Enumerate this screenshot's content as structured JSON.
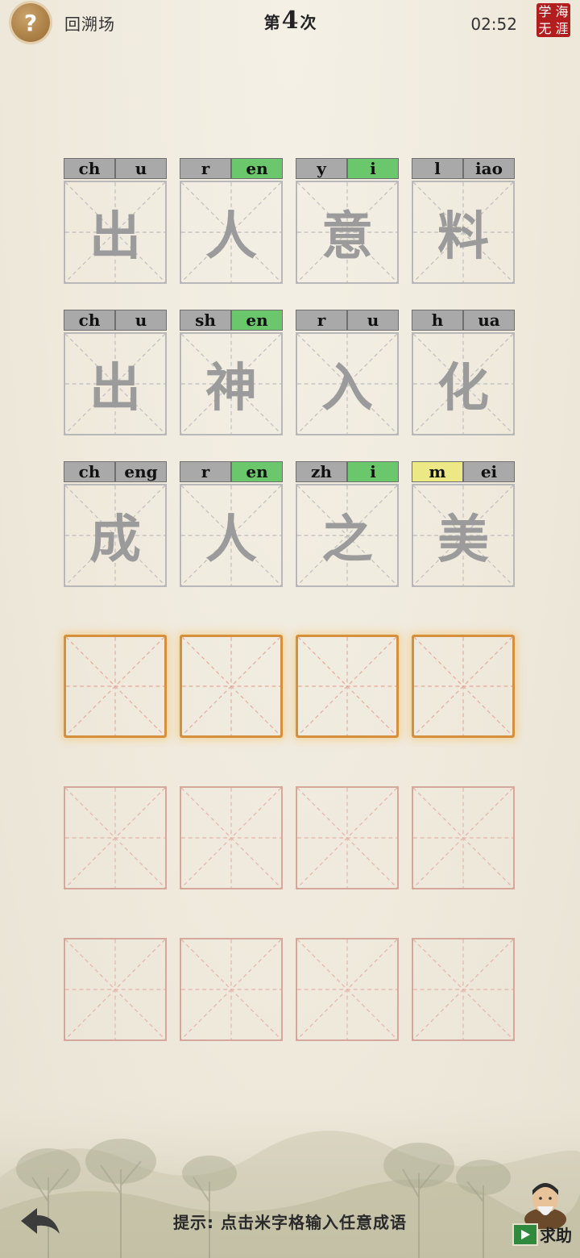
{
  "topbar": {
    "help_icon": "question-mark-icon",
    "help_symbol": "?",
    "mode_label": "回溯场",
    "round_prefix": "第",
    "round_number": "4",
    "round_suffix": "次",
    "timer": "02:52",
    "seal_chars": [
      "学",
      "海",
      "无",
      "涯"
    ]
  },
  "solved": [
    [
      {
        "char": "出",
        "initial": "ch",
        "final": "u",
        "initial_status": "gray",
        "final_status": "gray"
      },
      {
        "char": "人",
        "initial": "r",
        "final": "en",
        "initial_status": "gray",
        "final_status": "green"
      },
      {
        "char": "意",
        "initial": "y",
        "final": "i",
        "initial_status": "gray",
        "final_status": "green"
      },
      {
        "char": "料",
        "initial": "l",
        "final": "iao",
        "initial_status": "gray",
        "final_status": "gray"
      }
    ],
    [
      {
        "char": "出",
        "initial": "ch",
        "final": "u",
        "initial_status": "gray",
        "final_status": "gray"
      },
      {
        "char": "神",
        "initial": "sh",
        "final": "en",
        "initial_status": "gray",
        "final_status": "green"
      },
      {
        "char": "入",
        "initial": "r",
        "final": "u",
        "initial_status": "gray",
        "final_status": "gray"
      },
      {
        "char": "化",
        "initial": "h",
        "final": "ua",
        "initial_status": "gray",
        "final_status": "gray"
      }
    ],
    [
      {
        "char": "成",
        "initial": "ch",
        "final": "eng",
        "initial_status": "gray",
        "final_status": "gray"
      },
      {
        "char": "人",
        "initial": "r",
        "final": "en",
        "initial_status": "gray",
        "final_status": "green"
      },
      {
        "char": "之",
        "initial": "zh",
        "final": "i",
        "initial_status": "gray",
        "final_status": "green"
      },
      {
        "char": "美",
        "initial": "m",
        "final": "ei",
        "initial_status": "yellow",
        "final_status": "gray"
      }
    ]
  ],
  "status_colors": {
    "gray": "#a9a9a9",
    "green": "#6bc76b",
    "yellow": "#ece886"
  },
  "active_row_cells": 4,
  "empty_rows": 2,
  "bottom": {
    "hint": "提示: 点击米字格输入任意成语",
    "back_icon": "back-arrow-icon",
    "help_label": "求助",
    "video_icon": "video-play-icon",
    "avatar_icon": "sage-avatar-icon"
  }
}
